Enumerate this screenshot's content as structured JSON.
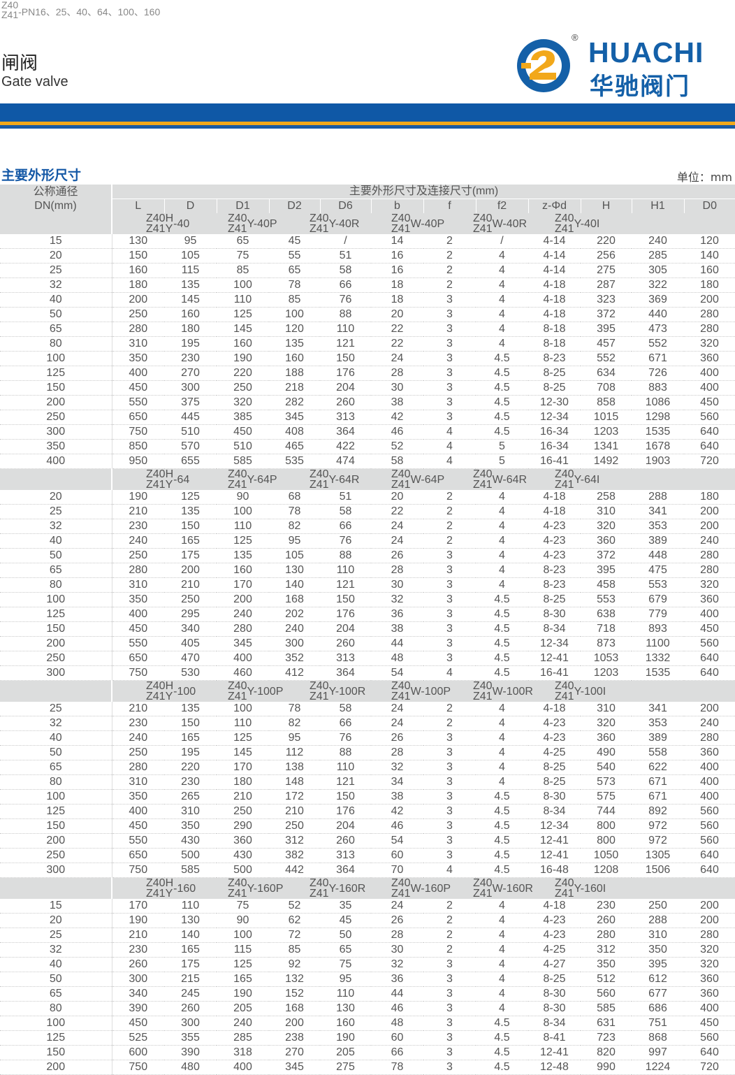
{
  "header": {
    "series_prefix": [
      "Z40",
      "Z41"
    ],
    "series_rest": "-PN16、25、40、64、100、160",
    "title_cn": "闸阀",
    "title_en": "Gate valve"
  },
  "logo": {
    "name_en": "HUACHI",
    "name_cn": "华驰阀门",
    "reg": "®",
    "colors": {
      "blue": "#1460a8",
      "yellow": "#f2a81a"
    }
  },
  "section": {
    "title": "主要外形尺寸",
    "unit": "单位：mm"
  },
  "table": {
    "dn_label": [
      "公称通径",
      "DN(mm)"
    ],
    "main_label": "主要外形尺寸及连接尺寸(mm)",
    "columns": [
      "L",
      "D",
      "D1",
      "D2",
      "D6",
      "b",
      "f",
      "f2",
      "z-Φd",
      "H",
      "H1",
      "D0"
    ],
    "groups": [
      {
        "models": [
          {
            "top": "Z40H",
            "bot": "Z41Y",
            "suffix": "-40"
          },
          {
            "top": "Z40",
            "bot": "Z41",
            "suffix": "Y-40P"
          },
          {
            "top": "Z40",
            "bot": "Z41",
            "suffix": "Y-40R"
          },
          {
            "top": "Z40",
            "bot": "Z41",
            "suffix": "W-40P"
          },
          {
            "top": "Z40",
            "bot": "Z41",
            "suffix": "W-40R"
          },
          {
            "top": "Z40",
            "bot": "Z41",
            "suffix": "Y-40I"
          }
        ],
        "rows": [
          [
            "15",
            "130",
            "95",
            "65",
            "45",
            "/",
            "14",
            "2",
            "/",
            "4-14",
            "220",
            "240",
            "120"
          ],
          [
            "20",
            "150",
            "105",
            "75",
            "55",
            "51",
            "16",
            "2",
            "4",
            "4-14",
            "256",
            "285",
            "140"
          ],
          [
            "25",
            "160",
            "115",
            "85",
            "65",
            "58",
            "16",
            "2",
            "4",
            "4-14",
            "275",
            "305",
            "160"
          ],
          [
            "32",
            "180",
            "135",
            "100",
            "78",
            "66",
            "18",
            "2",
            "4",
            "4-18",
            "287",
            "322",
            "180"
          ],
          [
            "40",
            "200",
            "145",
            "110",
            "85",
            "76",
            "18",
            "3",
            "4",
            "4-18",
            "323",
            "369",
            "200"
          ],
          [
            "50",
            "250",
            "160",
            "125",
            "100",
            "88",
            "20",
            "3",
            "4",
            "4-18",
            "372",
            "440",
            "280"
          ],
          [
            "65",
            "280",
            "180",
            "145",
            "120",
            "110",
            "22",
            "3",
            "4",
            "8-18",
            "395",
            "473",
            "280"
          ],
          [
            "80",
            "310",
            "195",
            "160",
            "135",
            "121",
            "22",
            "3",
            "4",
            "8-18",
            "457",
            "552",
            "320"
          ],
          [
            "100",
            "350",
            "230",
            "190",
            "160",
            "150",
            "24",
            "3",
            "4.5",
            "8-23",
            "552",
            "671",
            "360"
          ],
          [
            "125",
            "400",
            "270",
            "220",
            "188",
            "176",
            "28",
            "3",
            "4.5",
            "8-25",
            "634",
            "726",
            "400"
          ],
          [
            "150",
            "450",
            "300",
            "250",
            "218",
            "204",
            "30",
            "3",
            "4.5",
            "8-25",
            "708",
            "883",
            "400"
          ],
          [
            "200",
            "550",
            "375",
            "320",
            "282",
            "260",
            "38",
            "3",
            "4.5",
            "12-30",
            "858",
            "1086",
            "450"
          ],
          [
            "250",
            "650",
            "445",
            "385",
            "345",
            "313",
            "42",
            "3",
            "4.5",
            "12-34",
            "1015",
            "1298",
            "560"
          ],
          [
            "300",
            "750",
            "510",
            "450",
            "408",
            "364",
            "46",
            "4",
            "4.5",
            "16-34",
            "1203",
            "1535",
            "640"
          ],
          [
            "350",
            "850",
            "570",
            "510",
            "465",
            "422",
            "52",
            "4",
            "5",
            "16-34",
            "1341",
            "1678",
            "640"
          ],
          [
            "400",
            "950",
            "655",
            "585",
            "535",
            "474",
            "58",
            "4",
            "5",
            "16-41",
            "1492",
            "1903",
            "720"
          ]
        ]
      },
      {
        "models": [
          {
            "top": "Z40H",
            "bot": "Z41Y",
            "suffix": "-64"
          },
          {
            "top": "Z40",
            "bot": "Z41",
            "suffix": "Y-64P"
          },
          {
            "top": "Z40",
            "bot": "Z41",
            "suffix": "Y-64R"
          },
          {
            "top": "Z40",
            "bot": "Z41",
            "suffix": "W-64P"
          },
          {
            "top": "Z40",
            "bot": "Z41",
            "suffix": "W-64R"
          },
          {
            "top": "Z40",
            "bot": "Z41",
            "suffix": "Y-64I"
          }
        ],
        "rows": [
          [
            "20",
            "190",
            "125",
            "90",
            "68",
            "51",
            "20",
            "2",
            "4",
            "4-18",
            "258",
            "288",
            "180"
          ],
          [
            "25",
            "210",
            "135",
            "100",
            "78",
            "58",
            "22",
            "2",
            "4",
            "4-18",
            "310",
            "341",
            "200"
          ],
          [
            "32",
            "230",
            "150",
            "110",
            "82",
            "66",
            "24",
            "2",
            "4",
            "4-23",
            "320",
            "353",
            "200"
          ],
          [
            "40",
            "240",
            "165",
            "125",
            "95",
            "76",
            "24",
            "2",
            "4",
            "4-23",
            "360",
            "389",
            "240"
          ],
          [
            "50",
            "250",
            "175",
            "135",
            "105",
            "88",
            "26",
            "3",
            "4",
            "4-23",
            "372",
            "448",
            "280"
          ],
          [
            "65",
            "280",
            "200",
            "160",
            "130",
            "110",
            "28",
            "3",
            "4",
            "8-23",
            "395",
            "475",
            "280"
          ],
          [
            "80",
            "310",
            "210",
            "170",
            "140",
            "121",
            "30",
            "3",
            "4",
            "8-23",
            "458",
            "553",
            "320"
          ],
          [
            "100",
            "350",
            "250",
            "200",
            "168",
            "150",
            "32",
            "3",
            "4.5",
            "8-25",
            "553",
            "679",
            "360"
          ],
          [
            "125",
            "400",
            "295",
            "240",
            "202",
            "176",
            "36",
            "3",
            "4.5",
            "8-30",
            "638",
            "779",
            "400"
          ],
          [
            "150",
            "450",
            "340",
            "280",
            "240",
            "204",
            "38",
            "3",
            "4.5",
            "8-34",
            "718",
            "893",
            "450"
          ],
          [
            "200",
            "550",
            "405",
            "345",
            "300",
            "260",
            "44",
            "3",
            "4.5",
            "12-34",
            "873",
            "1100",
            "560"
          ],
          [
            "250",
            "650",
            "470",
            "400",
            "352",
            "313",
            "48",
            "3",
            "4.5",
            "12-41",
            "1053",
            "1332",
            "640"
          ],
          [
            "300",
            "750",
            "530",
            "460",
            "412",
            "364",
            "54",
            "4",
            "4.5",
            "16-41",
            "1203",
            "1535",
            "640"
          ]
        ]
      },
      {
        "models": [
          {
            "top": "Z40H",
            "bot": "Z41Y",
            "suffix": "-100"
          },
          {
            "top": "Z40",
            "bot": "Z41",
            "suffix": "Y-100P"
          },
          {
            "top": "Z40",
            "bot": "Z41",
            "suffix": "Y-100R"
          },
          {
            "top": "Z40",
            "bot": "Z41",
            "suffix": "W-100P"
          },
          {
            "top": "Z40",
            "bot": "Z41",
            "suffix": "W-100R"
          },
          {
            "top": "Z40",
            "bot": "Z41",
            "suffix": "Y-100I"
          }
        ],
        "rows": [
          [
            "25",
            "210",
            "135",
            "100",
            "78",
            "58",
            "24",
            "2",
            "4",
            "4-18",
            "310",
            "341",
            "200"
          ],
          [
            "32",
            "230",
            "150",
            "110",
            "82",
            "66",
            "24",
            "2",
            "4",
            "4-23",
            "320",
            "353",
            "240"
          ],
          [
            "40",
            "240",
            "165",
            "125",
            "95",
            "76",
            "26",
            "3",
            "4",
            "4-23",
            "360",
            "389",
            "280"
          ],
          [
            "50",
            "250",
            "195",
            "145",
            "112",
            "88",
            "28",
            "3",
            "4",
            "4-25",
            "490",
            "558",
            "360"
          ],
          [
            "65",
            "280",
            "220",
            "170",
            "138",
            "110",
            "32",
            "3",
            "4",
            "8-25",
            "540",
            "622",
            "400"
          ],
          [
            "80",
            "310",
            "230",
            "180",
            "148",
            "121",
            "34",
            "3",
            "4",
            "8-25",
            "573",
            "671",
            "400"
          ],
          [
            "100",
            "350",
            "265",
            "210",
            "172",
            "150",
            "38",
            "3",
            "4.5",
            "8-30",
            "575",
            "671",
            "400"
          ],
          [
            "125",
            "400",
            "310",
            "250",
            "210",
            "176",
            "42",
            "3",
            "4.5",
            "8-34",
            "744",
            "892",
            "560"
          ],
          [
            "150",
            "450",
            "350",
            "290",
            "250",
            "204",
            "46",
            "3",
            "4.5",
            "12-34",
            "800",
            "972",
            "560"
          ],
          [
            "200",
            "550",
            "430",
            "360",
            "312",
            "260",
            "54",
            "3",
            "4.5",
            "12-41",
            "800",
            "972",
            "560"
          ],
          [
            "250",
            "650",
            "500",
            "430",
            "382",
            "313",
            "60",
            "3",
            "4.5",
            "12-41",
            "1050",
            "1305",
            "640"
          ],
          [
            "300",
            "750",
            "585",
            "500",
            "442",
            "364",
            "70",
            "4",
            "4.5",
            "16-48",
            "1208",
            "1506",
            "640"
          ]
        ]
      },
      {
        "models": [
          {
            "top": "Z40H",
            "bot": "Z41Y",
            "suffix": "-160"
          },
          {
            "top": "Z40",
            "bot": "Z41",
            "suffix": "Y-160P"
          },
          {
            "top": "Z40",
            "bot": "Z41",
            "suffix": "Y-160R"
          },
          {
            "top": "Z40",
            "bot": "Z41",
            "suffix": "W-160P"
          },
          {
            "top": "Z40",
            "bot": "Z41",
            "suffix": "W-160R"
          },
          {
            "top": "Z40",
            "bot": "Z41",
            "suffix": "Y-160I"
          }
        ],
        "rows": [
          [
            "15",
            "170",
            "110",
            "75",
            "52",
            "35",
            "24",
            "2",
            "4",
            "4-18",
            "230",
            "250",
            "200"
          ],
          [
            "20",
            "190",
            "130",
            "90",
            "62",
            "45",
            "26",
            "2",
            "4",
            "4-23",
            "260",
            "288",
            "200"
          ],
          [
            "25",
            "210",
            "140",
            "100",
            "72",
            "50",
            "28",
            "2",
            "4",
            "4-23",
            "280",
            "310",
            "280"
          ],
          [
            "32",
            "230",
            "165",
            "115",
            "85",
            "65",
            "30",
            "2",
            "4",
            "4-25",
            "312",
            "350",
            "320"
          ],
          [
            "40",
            "260",
            "175",
            "125",
            "92",
            "75",
            "32",
            "3",
            "4",
            "4-27",
            "350",
            "395",
            "320"
          ],
          [
            "50",
            "300",
            "215",
            "165",
            "132",
            "95",
            "36",
            "3",
            "4",
            "8-25",
            "512",
            "612",
            "360"
          ],
          [
            "65",
            "340",
            "245",
            "190",
            "152",
            "110",
            "44",
            "3",
            "4",
            "8-30",
            "560",
            "677",
            "360"
          ],
          [
            "80",
            "390",
            "260",
            "205",
            "168",
            "130",
            "46",
            "3",
            "4",
            "8-30",
            "585",
            "686",
            "400"
          ],
          [
            "100",
            "450",
            "300",
            "240",
            "200",
            "160",
            "48",
            "3",
            "4.5",
            "8-34",
            "631",
            "751",
            "450"
          ],
          [
            "125",
            "525",
            "355",
            "285",
            "238",
            "190",
            "60",
            "3",
            "4.5",
            "8-41",
            "723",
            "868",
            "560"
          ],
          [
            "150",
            "600",
            "390",
            "318",
            "270",
            "205",
            "66",
            "3",
            "4.5",
            "12-41",
            "820",
            "997",
            "640"
          ],
          [
            "200",
            "750",
            "480",
            "400",
            "345",
            "275",
            "78",
            "3",
            "4.5",
            "12-48",
            "990",
            "1224",
            "720"
          ]
        ]
      }
    ]
  }
}
